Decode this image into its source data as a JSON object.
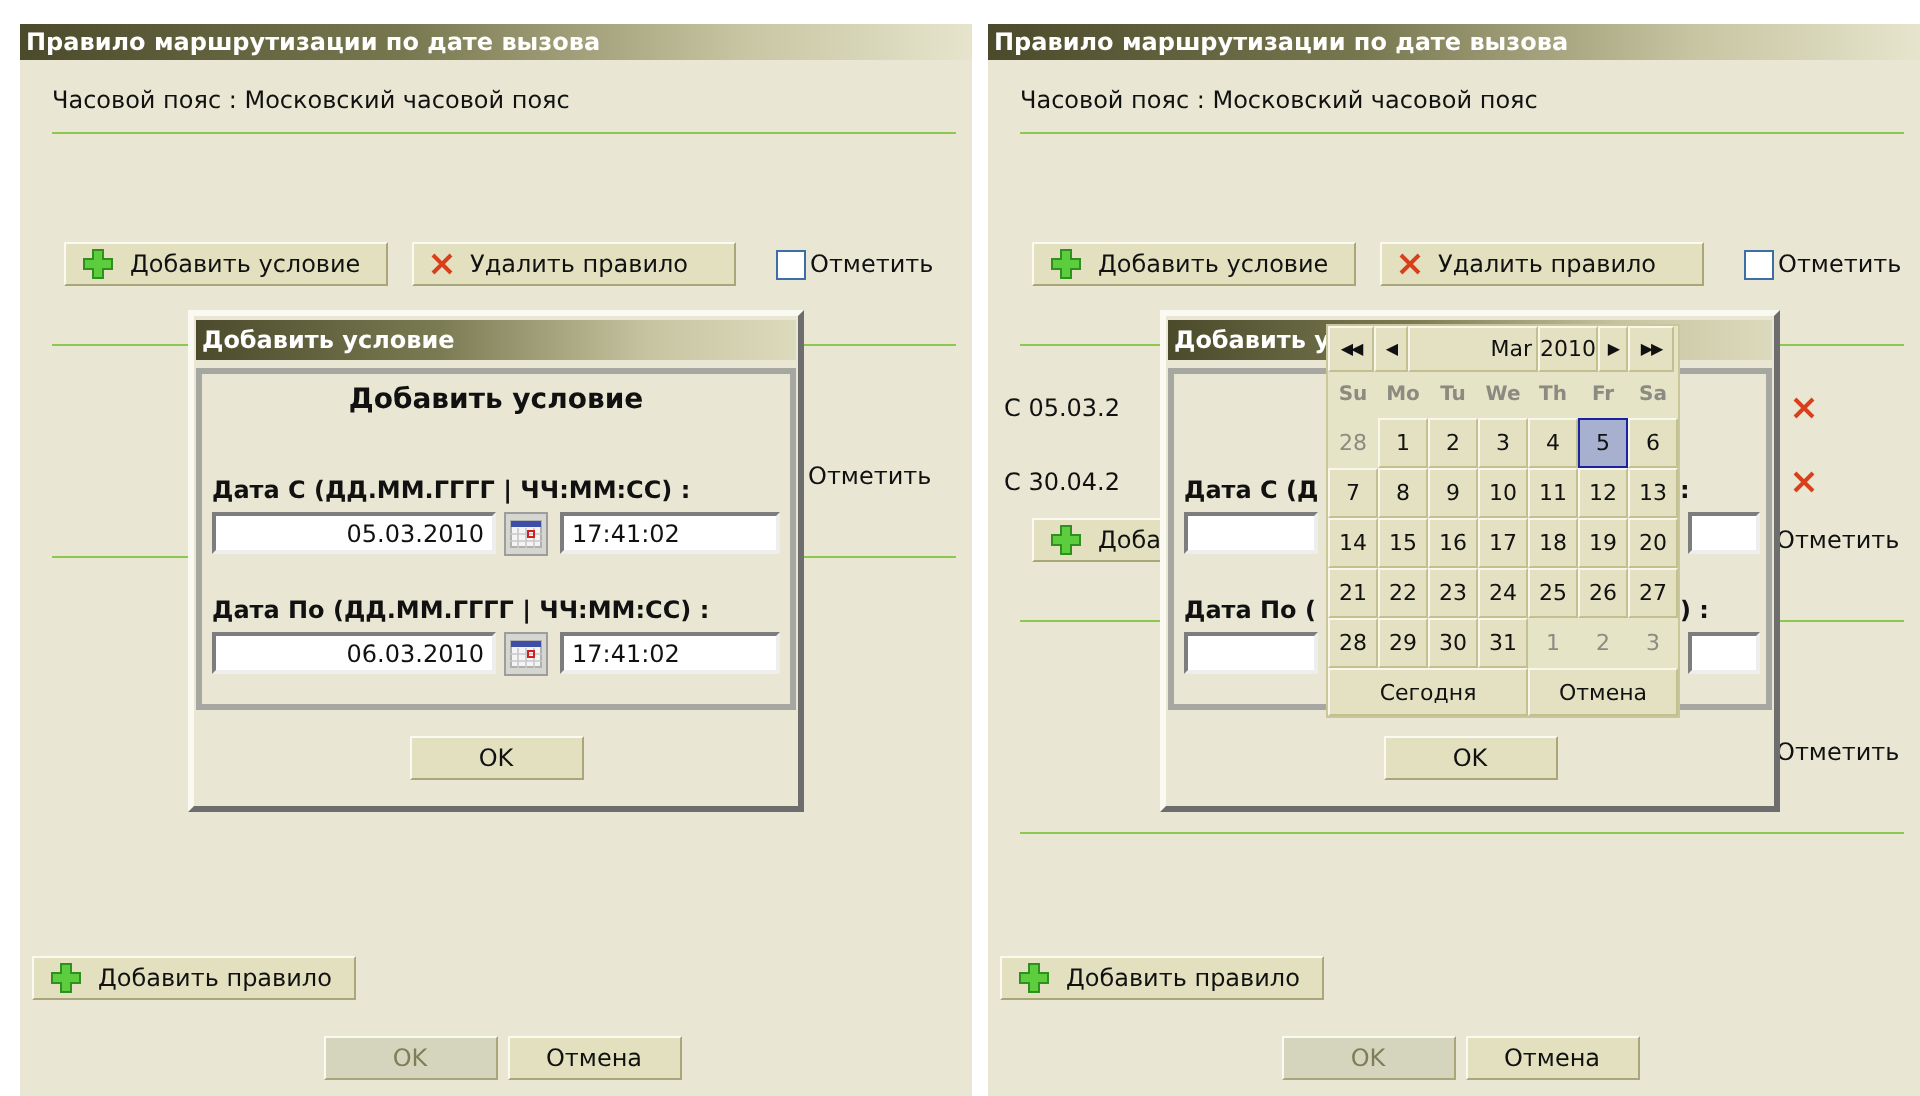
{
  "panels": [
    {
      "title": "Правило маршрутизации по дате вызова",
      "timezone": "Часовой пояс : Московский часовой пояс",
      "rules": [
        {
          "buttons": [
            {
              "kind": "add",
              "label": "Добавить условие"
            },
            {
              "kind": "delete",
              "label": "Удалить правило"
            }
          ],
          "mark": {
            "label": "Отметить",
            "checked": false
          }
        },
        {
          "mark": {
            "label": "Отметить"
          }
        }
      ],
      "add_rule": "Добавить правило",
      "footer": [
        {
          "label": "OK",
          "disabled": true
        },
        {
          "label": "Отмена",
          "disabled": false
        }
      ],
      "dialog": {
        "title": "Добавить условие",
        "heading": "Добавить условие",
        "fields": [
          {
            "label": "Дата С (ДД.ММ.ГГГГ | ЧЧ:ММ:СС) :",
            "date": "05.03.2010",
            "time": "17:41:02"
          },
          {
            "label": "Дата По (ДД.ММ.ГГГГ | ЧЧ:ММ:СС) :",
            "date": "06.03.2010",
            "time": "17:41:02"
          }
        ],
        "ok": "OK"
      }
    },
    {
      "title": "Правило маршрутизации по дате вызова",
      "timezone": "Часовой пояс : Московский часовой пояс",
      "rules": [
        {
          "buttons": [
            {
              "kind": "add",
              "label": "Добавить условие"
            },
            {
              "kind": "delete",
              "label": "Удалить правило"
            }
          ],
          "mark": {
            "label": "Отметить",
            "checked": false
          }
        },
        {
          "conditions": [
            "С 05.03.2",
            "С 30.04.2"
          ],
          "buttons": [
            {
              "kind": "add",
              "label": "Доба"
            }
          ],
          "mark": {
            "label": "Отметить"
          }
        },
        {
          "mark": {
            "label": "Отметить"
          }
        }
      ],
      "add_rule": "Добавить правило",
      "footer": [
        {
          "label": "OK",
          "disabled": true
        },
        {
          "label": "Отмена",
          "disabled": false
        }
      ],
      "dialog": {
        "title": "Добавить у",
        "fields": [
          {
            "label": "Дата С (Д",
            "label_tail": ":"
          },
          {
            "label": "Дата По (",
            "label_tail": ") :"
          }
        ],
        "ok": "OK",
        "calendar": {
          "prev": [
            "◀◀",
            "◀"
          ],
          "month": "Mar",
          "year": "2010",
          "next": [
            "▶",
            "▶▶"
          ],
          "weekdays": [
            "Su",
            "Mo",
            "Tu",
            "We",
            "Th",
            "Fr",
            "Sa"
          ],
          "weeks": [
            [
              {
                "day": "28",
                "other_month": true,
                "selected": false
              },
              {
                "day": "1",
                "other_month": false,
                "selected": false
              },
              {
                "day": "2",
                "other_month": false,
                "selected": false
              },
              {
                "day": "3",
                "other_month": false,
                "selected": false
              },
              {
                "day": "4",
                "other_month": false,
                "selected": false
              },
              {
                "day": "5",
                "other_month": false,
                "selected": true
              },
              {
                "day": "6",
                "other_month": false,
                "selected": false
              }
            ],
            [
              {
                "day": "7",
                "other_month": false,
                "selected": false
              },
              {
                "day": "8",
                "other_month": false,
                "selected": false
              },
              {
                "day": "9",
                "other_month": false,
                "selected": false
              },
              {
                "day": "10",
                "other_month": false,
                "selected": false
              },
              {
                "day": "11",
                "other_month": false,
                "selected": false
              },
              {
                "day": "12",
                "other_month": false,
                "selected": false
              },
              {
                "day": "13",
                "other_month": false,
                "selected": false
              }
            ],
            [
              {
                "day": "14",
                "other_month": false,
                "selected": false
              },
              {
                "day": "15",
                "other_month": false,
                "selected": false
              },
              {
                "day": "16",
                "other_month": false,
                "selected": false
              },
              {
                "day": "17",
                "other_month": false,
                "selected": false
              },
              {
                "day": "18",
                "other_month": false,
                "selected": false
              },
              {
                "day": "19",
                "other_month": false,
                "selected": false
              },
              {
                "day": "20",
                "other_month": false,
                "selected": false
              }
            ],
            [
              {
                "day": "21",
                "other_month": false,
                "selected": false
              },
              {
                "day": "22",
                "other_month": false,
                "selected": false
              },
              {
                "day": "23",
                "other_month": false,
                "selected": false
              },
              {
                "day": "24",
                "other_month": false,
                "selected": false
              },
              {
                "day": "25",
                "other_month": false,
                "selected": false
              },
              {
                "day": "26",
                "other_month": false,
                "selected": false
              },
              {
                "day": "27",
                "other_month": false,
                "selected": false
              }
            ],
            [
              {
                "day": "28",
                "other_month": false,
                "selected": false
              },
              {
                "day": "29",
                "other_month": false,
                "selected": false
              },
              {
                "day": "30",
                "other_month": false,
                "selected": false
              },
              {
                "day": "31",
                "other_month": false,
                "selected": false
              },
              {
                "day": "1",
                "other_month": true,
                "selected": false
              },
              {
                "day": "2",
                "other_month": true,
                "selected": false
              },
              {
                "day": "3",
                "other_month": true,
                "selected": false
              }
            ]
          ],
          "buttons": [
            "Сегодня",
            "Отмена"
          ]
        }
      }
    }
  ]
}
